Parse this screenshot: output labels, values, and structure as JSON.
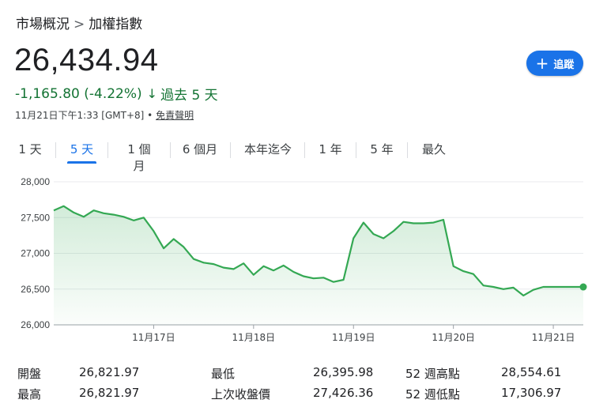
{
  "breadcrumb": {
    "parent": "市場概況",
    "separator": ">",
    "current": "加權指數"
  },
  "price": "26,434.94",
  "change": {
    "text": "-1,165.80 (-4.22%)",
    "arrow": "↓",
    "period": "過去 5 天",
    "color": "#137333"
  },
  "meta": {
    "timestamp": "11月21日下午1:33 [GMT+8]",
    "dot": "•",
    "disclaimer": "免責聲明"
  },
  "follow_button": {
    "label": "追蹤",
    "icon": "plus-icon",
    "color": "#1a73e8"
  },
  "tabs": [
    {
      "label": "1 天",
      "active": false
    },
    {
      "label": "5 天",
      "active": true
    },
    {
      "label": "1 個月",
      "active": false
    },
    {
      "label": "6 個月",
      "active": false
    },
    {
      "label": "本年迄今",
      "active": false
    },
    {
      "label": "1 年",
      "active": false
    },
    {
      "label": "5 年",
      "active": false
    },
    {
      "label": "最久",
      "active": false
    }
  ],
  "chart_data": {
    "type": "area",
    "ylim": [
      26000,
      28000
    ],
    "y_ticks": [
      "28,000",
      "27,500",
      "27,000",
      "26,500",
      "26,000"
    ],
    "y_tick_values": [
      28000,
      27500,
      27000,
      26500,
      26000
    ],
    "x_ticks": [
      "11月17日",
      "11月18日",
      "11月19日",
      "11月20日",
      "11月21日"
    ],
    "x_tick_values": [
      1,
      2,
      3,
      4,
      5
    ],
    "xlim": [
      0,
      5.3
    ],
    "grid": true,
    "line_color": "#34a853",
    "series": [
      {
        "x": [
          0,
          0.1,
          0.2,
          0.3,
          0.4,
          0.5,
          0.6,
          0.7,
          0.8,
          0.9,
          1.0,
          1.1,
          1.2,
          1.3,
          1.4,
          1.5,
          1.6,
          1.7,
          1.8,
          1.9,
          2.0,
          2.1,
          2.2,
          2.3,
          2.4,
          2.5,
          2.6,
          2.7,
          2.8,
          2.9,
          3.0,
          3.1,
          3.2,
          3.3,
          3.4,
          3.5,
          3.6,
          3.7,
          3.8,
          3.9,
          4.0,
          4.1,
          4.2,
          4.3,
          4.4,
          4.5,
          4.6,
          4.7,
          4.8,
          4.9,
          5.0,
          5.1,
          5.2,
          5.3
        ],
        "y": [
          27600,
          27660,
          27570,
          27510,
          27600,
          27560,
          27540,
          27510,
          27460,
          27500,
          27310,
          27070,
          27200,
          27090,
          26920,
          26870,
          26850,
          26800,
          26780,
          26860,
          26700,
          26820,
          26760,
          26830,
          26740,
          26680,
          26650,
          26660,
          26600,
          26630,
          27210,
          27430,
          27270,
          27210,
          27310,
          27440,
          27420,
          27420,
          27430,
          27470,
          26820,
          26750,
          26710,
          26550,
          26530,
          26500,
          26520,
          26410,
          26490,
          26530,
          26530,
          26530,
          26530,
          26530
        ]
      }
    ]
  },
  "stats": [
    {
      "label": "開盤",
      "value": "26,821.97"
    },
    {
      "label": "最高",
      "value": "26,821.97"
    },
    {
      "label": "最低",
      "value": "26,395.98"
    },
    {
      "label": "上次收盤價",
      "value": "27,426.36"
    },
    {
      "label": "52 週高點",
      "value": "28,554.61"
    },
    {
      "label": "52 週低點",
      "value": "17,306.97"
    }
  ]
}
